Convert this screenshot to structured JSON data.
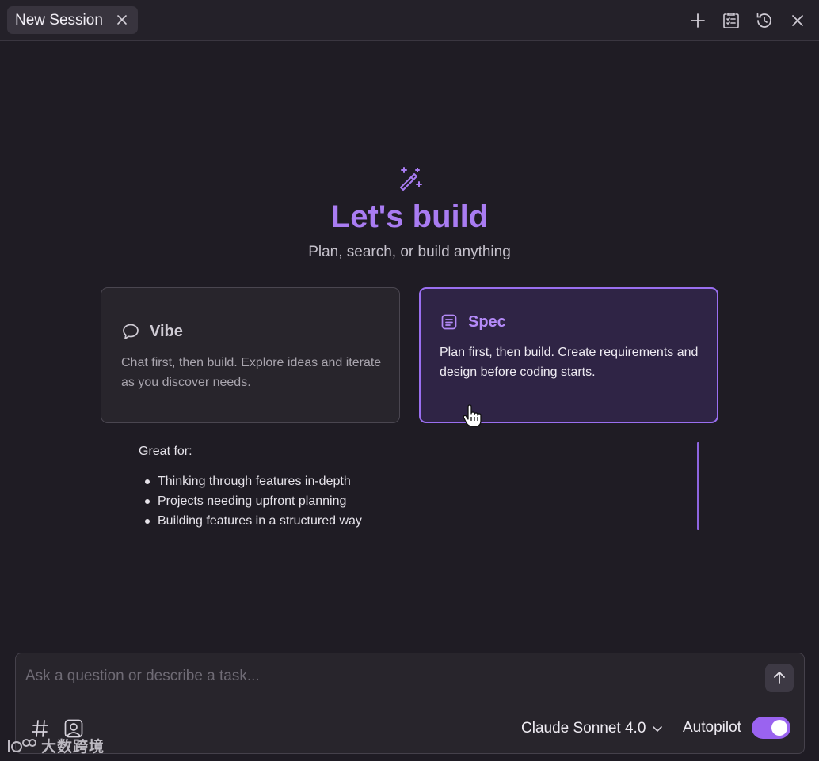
{
  "tabbar": {
    "tab_label": "New Session",
    "icons": [
      "close-icon",
      "plus-icon",
      "task-list-icon",
      "history-icon",
      "close-panel-icon"
    ]
  },
  "hero": {
    "icon": "magic-wand-icon",
    "title": "Let's build",
    "subtitle": "Plan, search, or build anything"
  },
  "cards": {
    "vibe": {
      "icon": "chat-bubble-icon",
      "title": "Vibe",
      "description": "Chat first, then build. Explore ideas and iterate as you discover needs."
    },
    "spec": {
      "icon": "document-list-icon",
      "title": "Spec",
      "description": "Plan first, then build. Create requirements and design before coding starts.",
      "selected": true
    }
  },
  "great_for": {
    "label": "Great for:",
    "items": [
      "Thinking through features in-depth",
      "Projects needing upfront planning",
      "Building features in a structured way"
    ]
  },
  "input": {
    "placeholder": "Ask a question or describe a task...",
    "value": "",
    "send_icon": "arrow-up-icon",
    "hash_icon": "hash-icon",
    "image_icon": "image-icon",
    "model": "Claude Sonnet 4.0",
    "autopilot_label": "Autopilot",
    "autopilot_on": true
  },
  "watermark": {
    "text": "大数跨境"
  },
  "colors": {
    "accent": "#9a63f0",
    "title": "#a97cf2",
    "background": "#1f1c24"
  }
}
